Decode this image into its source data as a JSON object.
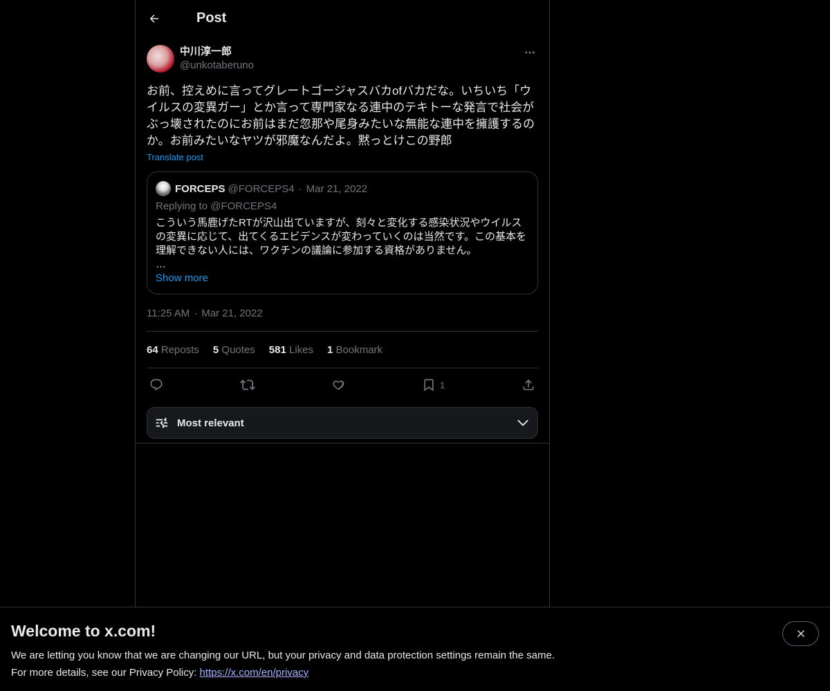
{
  "header": {
    "title": "Post"
  },
  "post": {
    "author_name": "中川淳一郎",
    "author_handle": "@unkotaberuno",
    "text": "お前、控えめに言ってグレートゴージャスバカofバカだな。いちいち「ウイルスの変異ガー」とか言って専門家なる連中のテキトーな発言で社会がぶっ壊されたのにお前はまだ忽那や尾身みたいな無能な連中を擁護するのか。お前みたいなヤツが邪魔なんだよ。黙っとけこの野郎",
    "translate_label": "Translate post",
    "time": "11:25 AM",
    "date": "Mar 21, 2022"
  },
  "quote": {
    "name": "FORCEPS",
    "handle": "@FORCEPS4",
    "date": "Mar 21, 2022",
    "replying_to": "Replying to @FORCEPS4",
    "text": "こういう馬鹿げたRTが沢山出ていますが、刻々と変化する感染状況やウイルスの変異に応じて、出てくるエビデンスが変わっていくのは当然です。この基本を理解できない人には、ワクチンの議論に参加する資格がありません。",
    "ellipsis": "…",
    "show_more": "Show more"
  },
  "stats": {
    "reposts_count": "64",
    "reposts_label": "Reposts",
    "quotes_count": "5",
    "quotes_label": "Quotes",
    "likes_count": "581",
    "likes_label": "Likes",
    "bookmarks_count": "1",
    "bookmarks_label": "Bookmark"
  },
  "actions": {
    "bookmark_count": "1"
  },
  "sort": {
    "label": "Most relevant"
  },
  "banner": {
    "title": "Welcome to x.com!",
    "line1": "We are letting you know that we are changing our URL, but your privacy and data protection settings remain the same.",
    "line2_prefix": "For more details, see our Privacy Policy: ",
    "privacy_link": "https://x.com/en/privacy"
  },
  "icons": {
    "back": "arrow-left-icon",
    "more": "more-horizontal-icon",
    "reply": "reply-icon",
    "repost": "repost-icon",
    "like": "heart-icon",
    "bookmark": "bookmark-icon",
    "share": "share-icon",
    "sort": "sliders-icon",
    "chevron": "chevron-down-icon",
    "close": "close-icon"
  },
  "colors": {
    "accent": "#1d9bf0",
    "background": "#000000",
    "muted": "#71767b",
    "border": "#2f3336"
  }
}
